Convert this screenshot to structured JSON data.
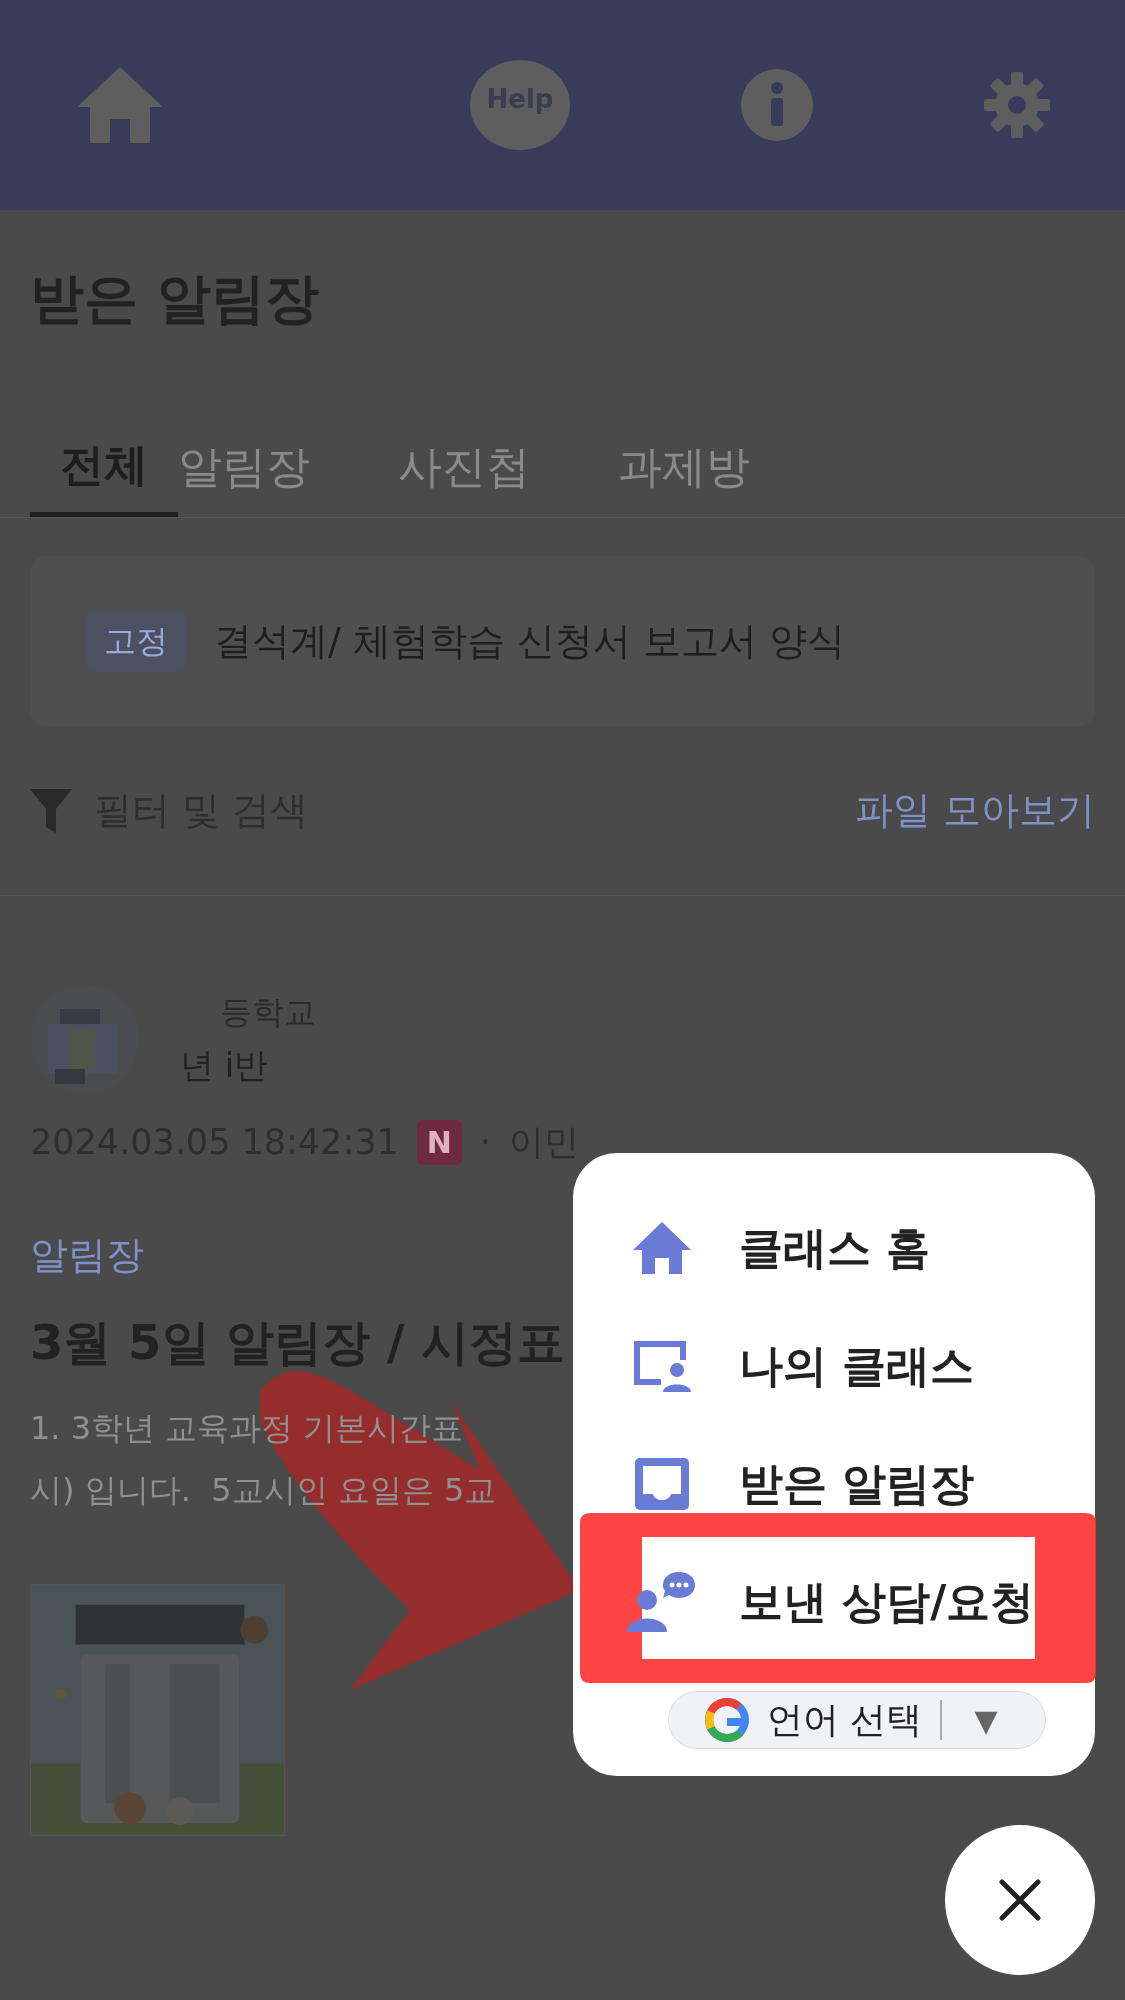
{
  "header": {
    "help_label": "Help"
  },
  "page_title": "받은 알림장",
  "tabs": [
    {
      "label": "전체",
      "selected": true
    },
    {
      "label": "알림장",
      "selected": false
    },
    {
      "label": "사진첩",
      "selected": false
    },
    {
      "label": "과제방",
      "selected": false
    }
  ],
  "pinned": {
    "tag": "고정",
    "title": "결석계/ 체험학습 신청서 보고서 양식"
  },
  "filter": {
    "label": "필터 및 검색",
    "files_link": "파일 모아보기"
  },
  "post": {
    "school": "등학교",
    "class": "년 i반",
    "date": "2024.03.05 18:42:31",
    "new_badge": "N",
    "separator": "·",
    "author": "이민",
    "category": "알림장",
    "title": "3월 5일 알림장 / 시정표",
    "body_lines": [
      "1. 3학년 교육과정 기본시간표",
      "시) 입니다.  5교시인 요일은 5교"
    ]
  },
  "menu": {
    "items": [
      {
        "kind": "home",
        "label": "클래스 홈"
      },
      {
        "kind": "class",
        "label": "나의 클래스"
      },
      {
        "kind": "inbox",
        "label": "받은 알림장"
      },
      {
        "kind": "consult",
        "label": "보낸 상담/요청"
      }
    ],
    "language": {
      "label": "언어 선택",
      "caret": "▼"
    }
  }
}
